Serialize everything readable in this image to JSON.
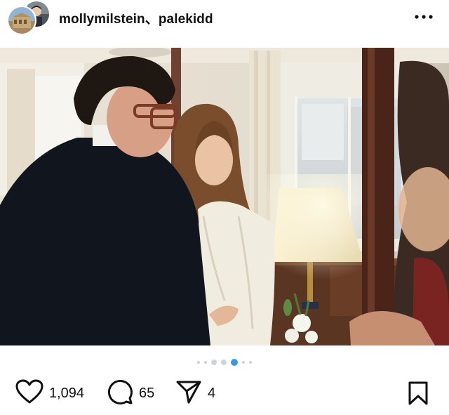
{
  "post": {
    "authors": "mollymilstein、palekidd",
    "more_icon": "more-horizontal-icon",
    "carousel": {
      "count": 8,
      "active_index": 4
    },
    "likes": "1,094",
    "comments": "65",
    "shares": "4"
  },
  "icons": {
    "like": "heart-icon",
    "comment": "comment-bubble-icon",
    "share": "paper-plane-icon",
    "save": "bookmark-icon"
  },
  "colors": {
    "accent": "#3797f0",
    "dot": "#cfd4da",
    "text": "#111111"
  }
}
